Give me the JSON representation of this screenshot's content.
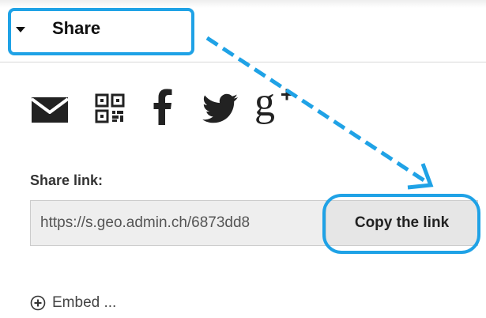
{
  "header": {
    "title": "Share"
  },
  "share_icons": [
    "mail-icon",
    "qr-code-icon",
    "facebook-icon",
    "twitter-icon",
    "google-plus-icon"
  ],
  "share_link": {
    "label": "Share link:",
    "url": "https://s.geo.admin.ch/6873dd8",
    "copy_button": "Copy the link"
  },
  "embed": {
    "label": "Embed ..."
  },
  "colors": {
    "highlight": "#1fa2e6"
  }
}
